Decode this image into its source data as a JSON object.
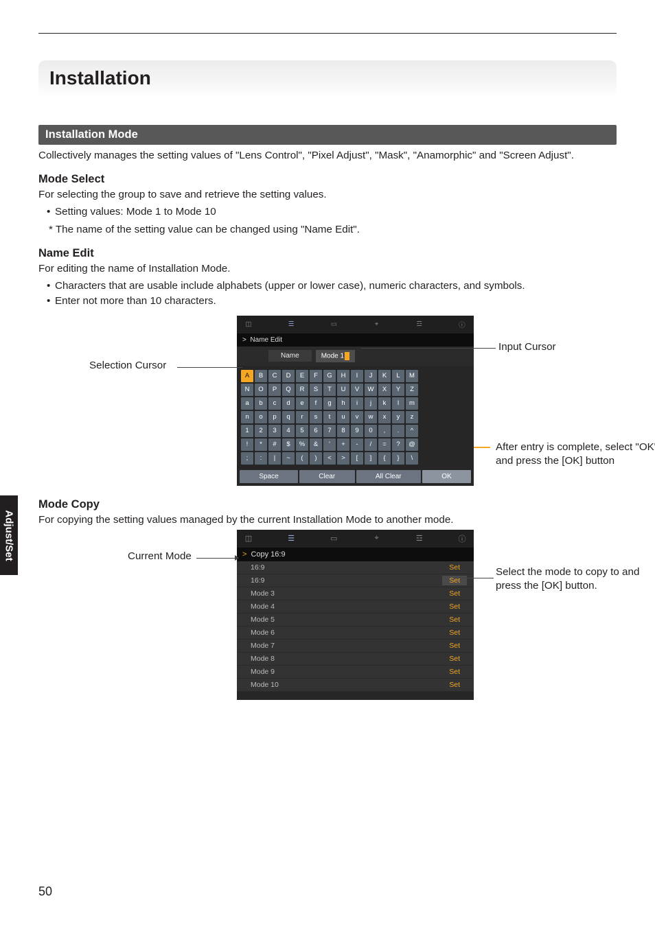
{
  "page": {
    "title": "Installation",
    "section": "Installation Mode",
    "intro": "Collectively manages the setting values of \"Lens Control\", \"Pixel Adjust\", \"Mask\", \"Anamorphic\" and \"Screen Adjust\".",
    "side_tab": "Adjust/Set",
    "page_number": "50"
  },
  "mode_select": {
    "heading": "Mode Select",
    "desc": "For selecting the group to save and retrieve the setting values.",
    "bullet1": "Setting values: Mode 1 to Mode 10",
    "star": "* The name of the setting value can be changed using \"Name Edit\"."
  },
  "name_edit": {
    "heading": "Name Edit",
    "desc": "For editing the name of Installation Mode.",
    "bullet1": "Characters that are usable include alphabets (upper or lower case), numeric characters, and symbols.",
    "bullet2": "Enter not more than 10 characters."
  },
  "fig1": {
    "crumb_prefix": ">",
    "crumb": "Name Edit",
    "name_label": "Name",
    "name_value": "Mode 1",
    "rows": [
      [
        "A",
        "B",
        "C",
        "D",
        "E",
        "F",
        "G",
        "H",
        "I",
        "J",
        "K",
        "L",
        "M"
      ],
      [
        "N",
        "O",
        "P",
        "Q",
        "R",
        "S",
        "T",
        "U",
        "V",
        "W",
        "X",
        "Y",
        "Z"
      ],
      [
        "a",
        "b",
        "c",
        "d",
        "e",
        "f",
        "g",
        "h",
        "i",
        "j",
        "k",
        "l",
        "m"
      ],
      [
        "n",
        "o",
        "p",
        "q",
        "r",
        "s",
        "t",
        "u",
        "v",
        "w",
        "x",
        "y",
        "z"
      ],
      [
        "1",
        "2",
        "3",
        "4",
        "5",
        "6",
        "7",
        "8",
        "9",
        "0",
        ",",
        ".",
        "^"
      ],
      [
        "!",
        "*",
        "#",
        "$",
        "%",
        "&",
        "'",
        "+",
        "-",
        "/",
        "=",
        "?",
        "@"
      ],
      [
        ";",
        ":",
        "|",
        "~",
        "(",
        ")",
        "<",
        ">",
        "[",
        "]",
        "{",
        "}",
        "\\"
      ]
    ],
    "btn_space": "Space",
    "btn_clear": "Clear",
    "btn_allclear": "All Clear",
    "btn_ok": "OK",
    "callout_selection": "Selection Cursor",
    "callout_input": "Input Cursor",
    "callout_ok": "After entry is complete, select \"OK\" and press the [OK] button"
  },
  "mode_copy": {
    "heading": "Mode Copy",
    "desc": "For copying the setting values managed by the current Installation Mode to another mode."
  },
  "fig2": {
    "crumb_prefix": ">",
    "crumb": "Copy 16:9",
    "rows": [
      {
        "name": "16:9",
        "set": "Set",
        "active": false
      },
      {
        "name": "16:9",
        "set": "Set",
        "active": true
      },
      {
        "name": "Mode 3",
        "set": "Set",
        "active": false
      },
      {
        "name": "Mode 4",
        "set": "Set",
        "active": false
      },
      {
        "name": "Mode 5",
        "set": "Set",
        "active": false
      },
      {
        "name": "Mode 6",
        "set": "Set",
        "active": false
      },
      {
        "name": "Mode 7",
        "set": "Set",
        "active": false
      },
      {
        "name": "Mode 8",
        "set": "Set",
        "active": false
      },
      {
        "name": "Mode 9",
        "set": "Set",
        "active": false
      },
      {
        "name": "Mode 10",
        "set": "Set",
        "active": false
      }
    ],
    "callout_current": "Current Mode",
    "callout_copyto": "Select the mode to copy to and press the [OK] button."
  }
}
